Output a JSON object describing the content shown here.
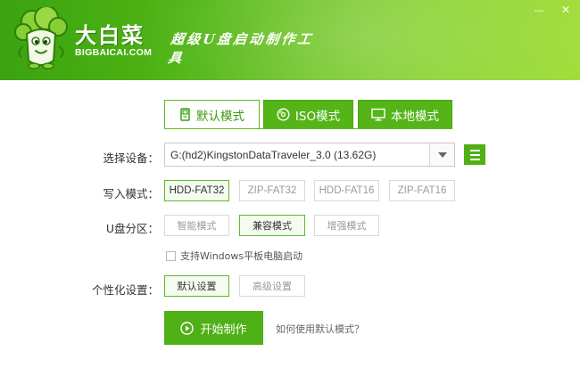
{
  "header": {
    "brand_cn": "大白菜",
    "brand_en": "BIGBAICAI.COM",
    "slogan": "超级U盘启动制作工具",
    "minimize": "—",
    "close": "✕"
  },
  "tabs": [
    {
      "label": "默认模式",
      "icon": "usb-drive-icon",
      "active": true
    },
    {
      "label": "ISO模式",
      "icon": "disc-icon",
      "active": false
    },
    {
      "label": "本地模式",
      "icon": "monitor-icon",
      "active": false
    }
  ],
  "device": {
    "label": "选择设备：",
    "value": "G:(hd2)KingstonDataTraveler_3.0 (13.62G)"
  },
  "write_mode": {
    "label": "写入模式：",
    "options": [
      "HDD-FAT32",
      "ZIP-FAT32",
      "HDD-FAT16",
      "ZIP-FAT16"
    ],
    "selected": "HDD-FAT32"
  },
  "partition": {
    "label": "U盘分区：",
    "options": [
      "智能模式",
      "兼容模式",
      "增强模式"
    ],
    "selected": "兼容模式"
  },
  "windows_tablet": {
    "label": "支持Windows平板电脑启动",
    "checked": false
  },
  "personalize": {
    "label": "个性化设置：",
    "options": [
      "默认设置",
      "高级设置"
    ],
    "selected": "默认设置"
  },
  "start_button": {
    "label": "开始制作"
  },
  "help_link": {
    "label": "如何使用默认模式？"
  },
  "colors": {
    "accent": "#4fb015",
    "header_start": "#3aa30f",
    "header_end": "#a2dd3a",
    "selected_border": "#5fb82a"
  }
}
